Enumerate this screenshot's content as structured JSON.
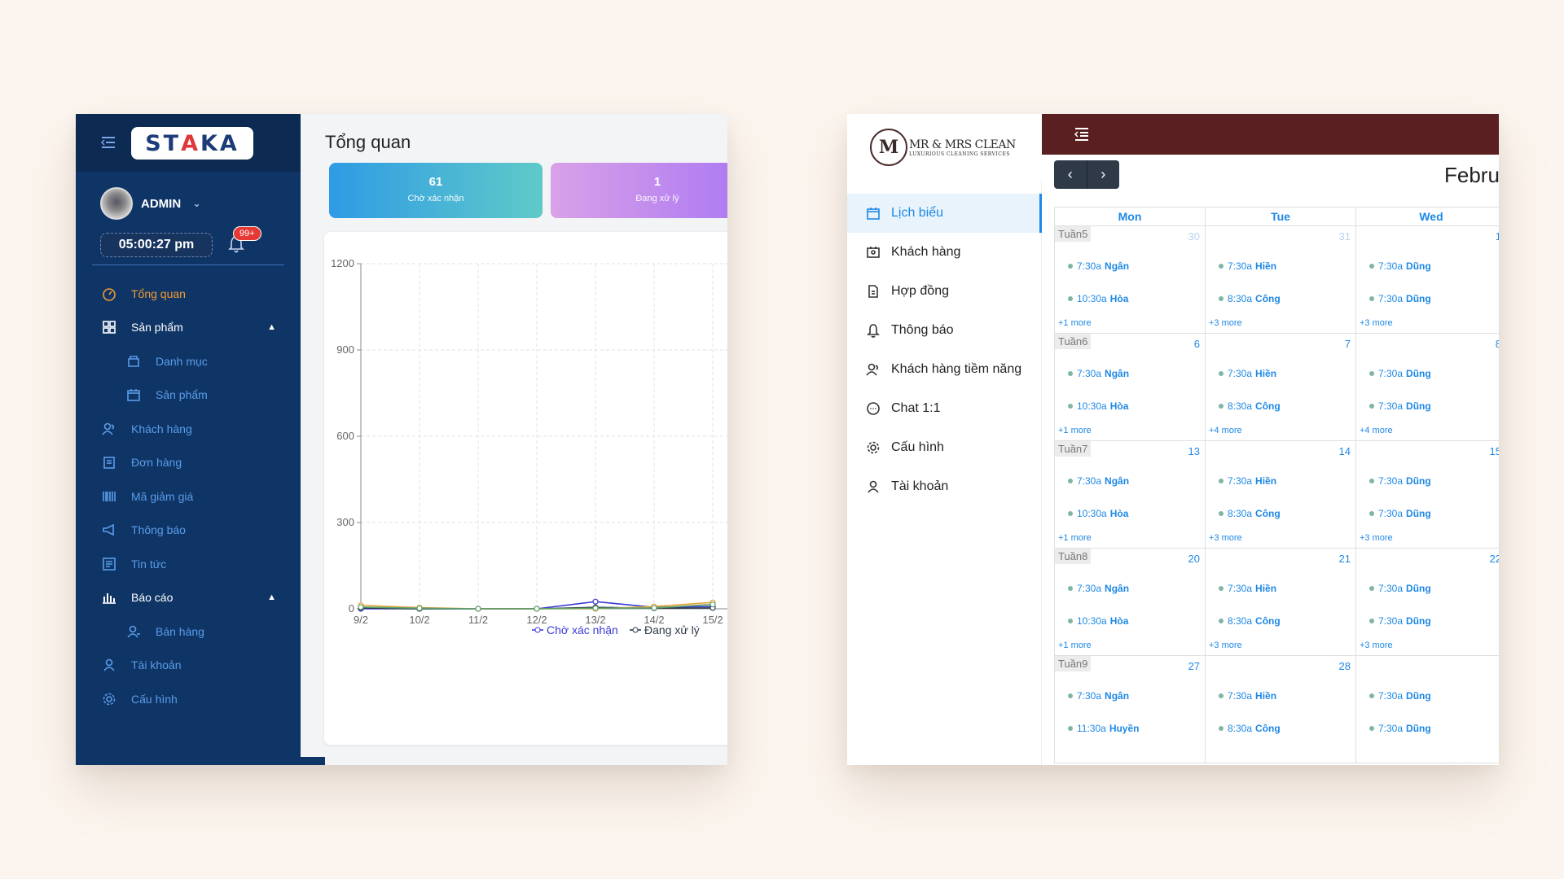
{
  "staka": {
    "logo": {
      "pre": "ST",
      "accent": "A",
      "post": "KA"
    },
    "user": {
      "name": "ADMIN"
    },
    "clock": "05:00:27 pm",
    "notification_badge": "99+",
    "menu": [
      {
        "label": "Tổng quan",
        "icon": "dashboard-icon",
        "state": "active"
      },
      {
        "label": "Sản phẩm",
        "icon": "grid-icon",
        "state": "open"
      },
      {
        "label": "Danh mục",
        "icon": "folder-icon",
        "state": "sub"
      },
      {
        "label": "Sản phẩm",
        "icon": "calendar-icon",
        "state": "sub"
      },
      {
        "label": "Khách hàng",
        "icon": "users-icon",
        "state": ""
      },
      {
        "label": "Đơn hàng",
        "icon": "orders-icon",
        "state": ""
      },
      {
        "label": "Mã giảm giá",
        "icon": "barcode-icon",
        "state": ""
      },
      {
        "label": "Thông báo",
        "icon": "megaphone-icon",
        "state": ""
      },
      {
        "label": "Tin tức",
        "icon": "news-icon",
        "state": ""
      },
      {
        "label": "Báo cáo",
        "icon": "bar-chart-icon",
        "state": "open"
      },
      {
        "label": "Bán hàng",
        "icon": "user-sales-icon",
        "state": "sub"
      },
      {
        "label": "Tài khoản",
        "icon": "user-icon",
        "state": ""
      },
      {
        "label": "Cấu hình",
        "icon": "gear-icon",
        "state": ""
      }
    ],
    "page_title": "Tổng quan",
    "cards": [
      {
        "value": "61",
        "label": "Chờ xác nhận"
      },
      {
        "value": "1",
        "label": "Đang xử lý"
      }
    ],
    "chart_data": {
      "type": "line",
      "x": [
        "9/2",
        "10/2",
        "11/2",
        "12/2",
        "13/2",
        "14/2",
        "15/2"
      ],
      "ylim": [
        0,
        1200
      ],
      "yticks": [
        0,
        300,
        600,
        900,
        1200
      ],
      "grid": true,
      "legend_position": "bottom-center",
      "series": [
        {
          "name": "Chờ xác nhận",
          "color": "#3b3bd6",
          "values": [
            0,
            0,
            0,
            0,
            25,
            5,
            8
          ]
        },
        {
          "name": "Đang xử lý",
          "color": "#2e3a48",
          "values": [
            3,
            0,
            0,
            0,
            5,
            2,
            3
          ]
        },
        {
          "name": "",
          "color": "#e8a33a",
          "values": [
            12,
            4,
            0,
            0,
            0,
            8,
            22
          ]
        },
        {
          "name": "",
          "color": "#5aa26a",
          "values": [
            6,
            2,
            0,
            0,
            2,
            3,
            15
          ]
        }
      ]
    }
  },
  "clean": {
    "logo_mark": "M",
    "logo_title": "MR & MRS CLEAN",
    "logo_subtitle": "LUXURIOUS CLEANING SERVICES",
    "menu": [
      {
        "label": "Lịch biểu",
        "icon": "calendar-icon",
        "active": true
      },
      {
        "label": "Khách hàng",
        "icon": "id-card-icon",
        "active": false
      },
      {
        "label": "Hợp đồng",
        "icon": "document-icon",
        "active": false
      },
      {
        "label": "Thông báo",
        "icon": "bell-icon",
        "active": false
      },
      {
        "label": "Khách hàng tiềm năng",
        "icon": "users-icon",
        "active": false
      },
      {
        "label": "Chat 1:1",
        "icon": "chat-icon",
        "active": false
      },
      {
        "label": "Cấu hình",
        "icon": "gear-icon",
        "active": false
      },
      {
        "label": "Tài khoản",
        "icon": "user-icon",
        "active": false
      }
    ],
    "nav": {
      "prev": "‹",
      "next": "›"
    },
    "month_label": "Febru",
    "day_headers": [
      "Mon",
      "Tue",
      "Wed"
    ],
    "weeks": [
      {
        "label": "Tuần5",
        "dates": [
          "30",
          "31",
          "1"
        ],
        "dim": [
          true,
          true,
          false
        ],
        "events": [
          [
            [
              "7:30a",
              "Ngân"
            ],
            [
              "10:30a",
              "Hòa"
            ]
          ],
          [
            [
              "7:30a",
              "Hiền"
            ],
            [
              "8:30a",
              "Công"
            ]
          ],
          [
            [
              "7:30a",
              "Dũng"
            ],
            [
              "7:30a",
              "Dũng"
            ]
          ]
        ],
        "more": [
          "+1 more",
          "+3 more",
          "+3 more"
        ]
      },
      {
        "label": "Tuần6",
        "dates": [
          "6",
          "7",
          "8"
        ],
        "dim": [
          false,
          false,
          false
        ],
        "events": [
          [
            [
              "7:30a",
              "Ngân"
            ],
            [
              "10:30a",
              "Hòa"
            ]
          ],
          [
            [
              "7:30a",
              "Hiền"
            ],
            [
              "8:30a",
              "Công"
            ]
          ],
          [
            [
              "7:30a",
              "Dũng"
            ],
            [
              "7:30a",
              "Dũng"
            ]
          ]
        ],
        "more": [
          "+1 more",
          "+4 more",
          "+4 more"
        ]
      },
      {
        "label": "Tuần7",
        "dates": [
          "13",
          "14",
          "15"
        ],
        "dim": [
          false,
          false,
          false
        ],
        "events": [
          [
            [
              "7:30a",
              "Ngân"
            ],
            [
              "10:30a",
              "Hòa"
            ]
          ],
          [
            [
              "7:30a",
              "Hiền"
            ],
            [
              "8:30a",
              "Công"
            ]
          ],
          [
            [
              "7:30a",
              "Dũng"
            ],
            [
              "7:30a",
              "Dũng"
            ]
          ]
        ],
        "more": [
          "+1 more",
          "+3 more",
          "+3 more"
        ]
      },
      {
        "label": "Tuần8",
        "dates": [
          "20",
          "21",
          "22"
        ],
        "dim": [
          false,
          false,
          false
        ],
        "events": [
          [
            [
              "7:30a",
              "Ngân"
            ],
            [
              "10:30a",
              "Hòa"
            ]
          ],
          [
            [
              "7:30a",
              "Hiền"
            ],
            [
              "8:30a",
              "Công"
            ]
          ],
          [
            [
              "7:30a",
              "Dũng"
            ],
            [
              "7:30a",
              "Dũng"
            ]
          ]
        ],
        "more": [
          "+1 more",
          "+3 more",
          "+3 more"
        ]
      },
      {
        "label": "Tuần9",
        "dates": [
          "27",
          "28",
          ""
        ],
        "dim": [
          false,
          false,
          false
        ],
        "events": [
          [
            [
              "7:30a",
              "Ngân"
            ],
            [
              "11:30a",
              "Huyền"
            ]
          ],
          [
            [
              "7:30a",
              "Hiền"
            ],
            [
              "8:30a",
              "Công"
            ]
          ],
          [
            [
              "7:30a",
              "Dũng"
            ],
            [
              "7:30a",
              "Dũng"
            ]
          ]
        ],
        "more": [
          "",
          "",
          ""
        ]
      }
    ]
  }
}
